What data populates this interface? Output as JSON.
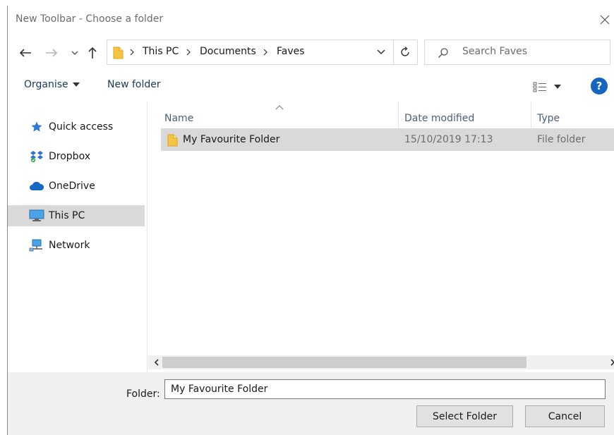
{
  "window": {
    "title": "New Toolbar - Choose a folder"
  },
  "address": {
    "breadcrumbs": [
      "This PC",
      "Documents",
      "Faves"
    ]
  },
  "search": {
    "placeholder": "Search Faves"
  },
  "toolbar": {
    "organise_label": "Organise",
    "new_folder_label": "New folder",
    "help_label": "?"
  },
  "navpane": {
    "items": [
      {
        "label": "Quick access",
        "icon": "star-icon"
      },
      {
        "label": "Dropbox",
        "icon": "dropbox-icon"
      },
      {
        "label": "OneDrive",
        "icon": "cloud-icon"
      },
      {
        "label": "This PC",
        "icon": "monitor-icon",
        "selected": true
      },
      {
        "label": "Network",
        "icon": "network-icon"
      }
    ]
  },
  "filelist": {
    "columns": [
      "Name",
      "Date modified",
      "Type"
    ],
    "rows": [
      {
        "name": "My Favourite Folder",
        "date": "15/10/2019 17:13",
        "type": "File folder",
        "selected": true
      }
    ]
  },
  "footer": {
    "folder_label": "Folder:",
    "folder_value": "My Favourite Folder",
    "select_label": "Select Folder",
    "cancel_label": "Cancel"
  },
  "colors": {
    "accent": "#1565c0",
    "selection": "#d9d9d9",
    "folder": "#f5c542"
  }
}
